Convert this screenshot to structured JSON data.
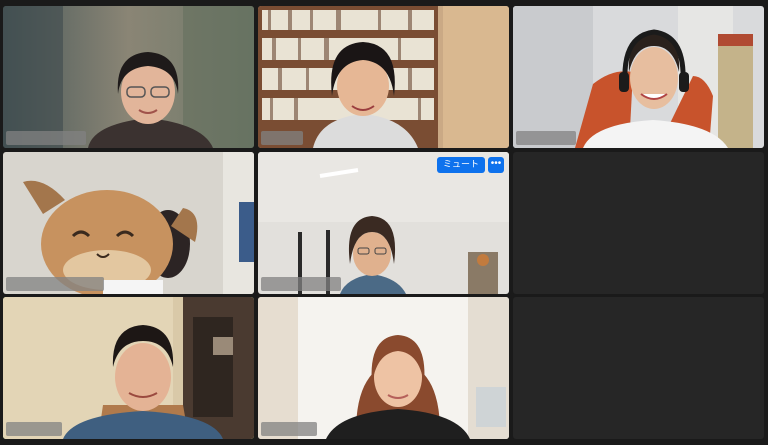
{
  "meeting": {
    "layout": "gallery-3x3",
    "colors": {
      "active_speaker_border": "#3ccf4e",
      "button_blue": "#0e72ed",
      "background": "#1a1a1a"
    }
  },
  "tiles": [
    {
      "name": "",
      "has_video": true,
      "active": false
    },
    {
      "name": "",
      "has_video": true,
      "active": false
    },
    {
      "name": "",
      "has_video": true,
      "active": false
    },
    {
      "name": "",
      "has_video": true,
      "active": false
    },
    {
      "name": "",
      "has_video": true,
      "active": false,
      "hover_controls": {
        "mute_label": "ミュート",
        "more_icon": "ellipsis-icon"
      }
    },
    {
      "name": "",
      "has_video": false,
      "active": false
    },
    {
      "name": "",
      "has_video": true,
      "active": true
    },
    {
      "name": "",
      "has_video": true,
      "active": false
    },
    {
      "name": "",
      "has_video": false,
      "active": false
    }
  ],
  "more_label": "•••"
}
